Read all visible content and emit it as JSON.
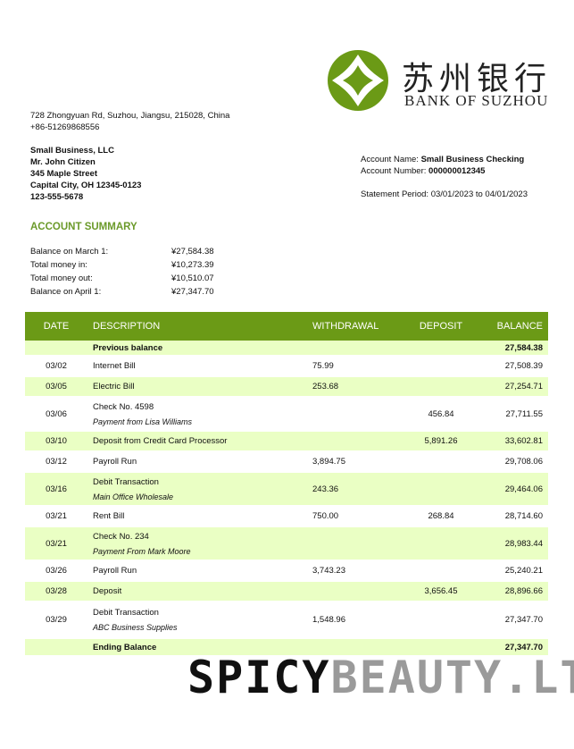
{
  "bank": {
    "name_cn": "苏州银行",
    "name_en": "BANK OF SUZHOU",
    "address": "728 Zhongyuan Rd, Suzhou, Jiangsu, 215028, China",
    "phone": "+86-51269868556",
    "brand_color": "#6b9a16"
  },
  "customer": {
    "lines": [
      "Small Business, LLC",
      "Mr. John Citizen",
      "345 Maple Street",
      "Capital City, OH 12345-0123",
      "123-555-5678"
    ]
  },
  "account": {
    "name_label": "Account Name:",
    "name_value": "Small Business Checking",
    "number_label": "Account Number:",
    "number_value": "000000012345",
    "period_label": "Statement Period:",
    "period_value": "03/01/2023 to 04/01/2023"
  },
  "summary": {
    "title": "ACCOUNT SUMMARY",
    "rows": [
      {
        "label": "Balance on March 1:",
        "value": "¥27,584.38"
      },
      {
        "label": "Total money in:",
        "value": "¥10,273.39"
      },
      {
        "label": "Total money out:",
        "value": "¥10,510.07"
      },
      {
        "label": "Balance on April 1:",
        "value": "¥27,347.70"
      }
    ]
  },
  "table": {
    "headers": {
      "date": "DATE",
      "desc": "DESCRIPTION",
      "withdrawal": "WITHDRAWAL",
      "deposit": "DEPOSIT",
      "balance": "BALANCE"
    },
    "rows": [
      {
        "date": "",
        "desc": "Previous balance",
        "sub": "",
        "withdrawal": "",
        "deposit": "",
        "balance": "27,584.38"
      },
      {
        "date": "03/02",
        "desc": "Internet Bill",
        "sub": "",
        "withdrawal": "75.99",
        "deposit": "",
        "balance": "27,508.39"
      },
      {
        "date": "03/05",
        "desc": "Electric Bill",
        "sub": "",
        "withdrawal": "253.68",
        "deposit": "",
        "balance": "27,254.71"
      },
      {
        "date": "03/06",
        "desc": "Check No. 4598",
        "sub": "Payment from Lisa Williams",
        "withdrawal": "",
        "deposit": "456.84",
        "balance": "27,711.55"
      },
      {
        "date": "03/10",
        "desc": "Deposit from Credit Card Processor",
        "sub": "",
        "withdrawal": "",
        "deposit": "5,891.26",
        "balance": "33,602.81"
      },
      {
        "date": "03/12",
        "desc": "Payroll Run",
        "sub": "",
        "withdrawal": "3,894.75",
        "deposit": "",
        "balance": "29,708.06"
      },
      {
        "date": "03/16",
        "desc": "Debit Transaction",
        "sub": "Main Office Wholesale",
        "withdrawal": "243.36",
        "deposit": "",
        "balance": "29,464.06"
      },
      {
        "date": "03/21",
        "desc": "Rent Bill",
        "sub": "",
        "withdrawal": "750.00",
        "deposit": "268.84",
        "balance": "28,714.60"
      },
      {
        "date": "03/21",
        "desc": "Check No. 234",
        "sub": "Payment From Mark Moore",
        "withdrawal": "",
        "deposit": "",
        "balance": "28,983.44"
      },
      {
        "date": "03/26",
        "desc": "Payroll Run",
        "sub": "",
        "withdrawal": "3,743.23",
        "deposit": "",
        "balance": "25,240.21"
      },
      {
        "date": "03/28",
        "desc": "Deposit",
        "sub": "",
        "withdrawal": "",
        "deposit": "3,656.45",
        "balance": "28,896.66"
      },
      {
        "date": "03/29",
        "desc": "Debit Transaction",
        "sub": "ABC Business Supplies",
        "withdrawal": "1,548.96",
        "deposit": "",
        "balance": "27,347.70"
      },
      {
        "date": "",
        "desc": "Ending Balance",
        "sub": "",
        "withdrawal": "",
        "deposit": "",
        "balance": "27,347.70"
      }
    ]
  },
  "watermark": {
    "part1": "SPICY",
    "part2": "BEAUTY.LT"
  }
}
